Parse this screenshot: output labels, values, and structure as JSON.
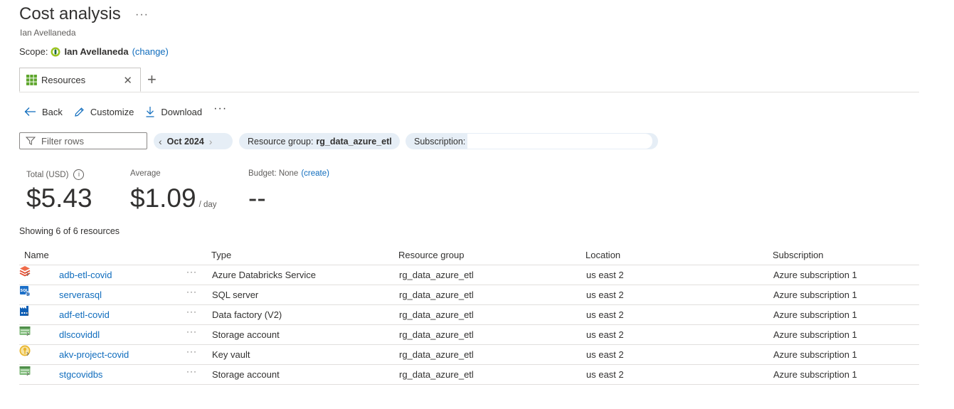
{
  "header": {
    "title": "Cost analysis",
    "more": "···",
    "subtitle": "Ian Avellaneda",
    "scope_label": "Scope:",
    "scope_name": "Ian Avellaneda",
    "scope_change": "(change)"
  },
  "tabs": {
    "active_label": "Resources",
    "close": "✕",
    "add": "+"
  },
  "toolbar": {
    "back": "Back",
    "customize": "Customize",
    "download": "Download",
    "more": "···"
  },
  "filters": {
    "filter_placeholder": "Filter rows",
    "date": "Oct 2024",
    "prev": "‹",
    "next": "›",
    "rg_label": "Resource group:",
    "rg_value": "rg_data_azure_etl",
    "subscription_label": "Subscription:"
  },
  "kpis": {
    "total_label": "Total (USD)",
    "total_info": "i",
    "total_value": "$5.43",
    "average_label": "Average",
    "average_value": "$1.09",
    "average_unit": "/ day",
    "budget_label": "Budget: None",
    "budget_link": "(create)",
    "budget_value": "--"
  },
  "showing": "Showing 6 of 6 resources",
  "table": {
    "columns": [
      "Name",
      "Type",
      "Resource group",
      "Location",
      "Subscription"
    ],
    "rows": [
      {
        "name": "adb-etl-covid",
        "icon": "databricks-icon",
        "type": "Azure Databricks Service",
        "rg": "rg_data_azure_etl",
        "location": "us east 2",
        "subscription": "Azure subscription 1"
      },
      {
        "name": "serverasql",
        "icon": "sql-server-icon",
        "type": "SQL server",
        "rg": "rg_data_azure_etl",
        "location": "us east 2",
        "subscription": "Azure subscription 1"
      },
      {
        "name": "adf-etl-covid",
        "icon": "data-factory-icon",
        "type": "Data factory (V2)",
        "rg": "rg_data_azure_etl",
        "location": "us east 2",
        "subscription": "Azure subscription 1"
      },
      {
        "name": "dlscoviddl",
        "icon": "storage-account-icon",
        "type": "Storage account",
        "rg": "rg_data_azure_etl",
        "location": "us east 2",
        "subscription": "Azure subscription 1"
      },
      {
        "name": "akv-project-covid",
        "icon": "key-vault-icon",
        "type": "Key vault",
        "rg": "rg_data_azure_etl",
        "location": "us east 2",
        "subscription": "Azure subscription 1"
      },
      {
        "name": "stgcovidbs",
        "icon": "storage-account-icon",
        "type": "Storage account",
        "rg": "rg_data_azure_etl",
        "location": "us east 2",
        "subscription": "Azure subscription 1"
      }
    ],
    "row_more": "···",
    "expand": "›"
  },
  "colors": {
    "link": "#0f6cbd",
    "pill_bg": "#e6eef6",
    "text": "#323130",
    "muted": "#605e5c"
  }
}
